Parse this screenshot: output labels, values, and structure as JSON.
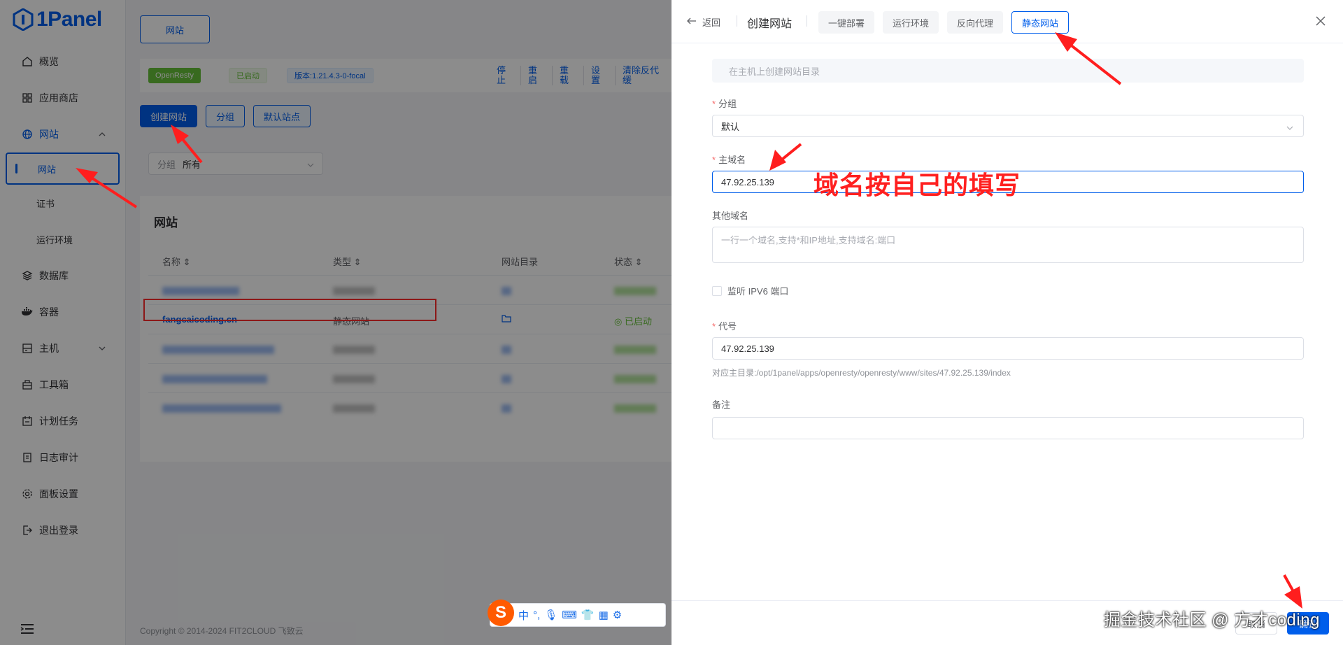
{
  "app": {
    "name": "1Panel"
  },
  "sidebar": {
    "items": [
      {
        "label": "概览",
        "icon": "home-icon"
      },
      {
        "label": "应用商店",
        "icon": "grid-icon"
      },
      {
        "label": "网站",
        "icon": "globe-icon"
      },
      {
        "label": "数据库",
        "icon": "layers-icon"
      },
      {
        "label": "容器",
        "icon": "docker-icon"
      },
      {
        "label": "主机",
        "icon": "server-icon"
      },
      {
        "label": "工具箱",
        "icon": "toolbox-icon"
      },
      {
        "label": "计划任务",
        "icon": "calendar-icon"
      },
      {
        "label": "日志审计",
        "icon": "document-icon"
      },
      {
        "label": "面板设置",
        "icon": "gear-icon"
      },
      {
        "label": "退出登录",
        "icon": "logout-icon"
      }
    ],
    "website_sub": [
      "网站",
      "证书",
      "运行环境"
    ]
  },
  "main": {
    "top_tab": "网站",
    "status": {
      "app": "OpenResty",
      "state": "已启动",
      "version": "版本:1.21.4.3-0-focal",
      "actions": [
        "停止",
        "重启",
        "重载",
        "设置",
        "清除反代缓"
      ]
    },
    "buttons": {
      "create": "创建网站",
      "group": "分组",
      "default_site": "默认站点"
    },
    "filter": {
      "label": "分组",
      "value": "所有"
    },
    "table": {
      "title": "网站",
      "headers": [
        "名称",
        "类型",
        "网站目录",
        "状态"
      ],
      "highlight_row": {
        "name": "fangcaicoding.cn",
        "type": "静态网站",
        "status": "已启动"
      }
    },
    "footer": "Copyright © 2014-2024 FIT2CLOUD 飞致云"
  },
  "ime": {
    "mode": "中"
  },
  "drawer": {
    "back": "返回",
    "title": "创建网站",
    "tabs": [
      "一键部署",
      "运行环境",
      "反向代理",
      "静态网站"
    ],
    "active_tab": "静态网站",
    "form": {
      "dir_placeholder": "在主机上创建网站目录",
      "group_label": "分组",
      "group_value": "默认",
      "domain_label": "主域名",
      "domain_value": "47.92.25.139",
      "other_label": "其他域名",
      "other_placeholder": "一行一个域名,支持*和IP地址,支持域名:端口",
      "ipv6_label": "监听 IPV6 端口",
      "code_label": "代号",
      "code_value": "47.92.25.139",
      "code_hint": "对应主目录:/opt/1panel/apps/openresty/openresty/www/sites/47.92.25.139/index",
      "remark_label": "备注"
    },
    "footer": {
      "cancel": "取消",
      "confirm": "确认"
    }
  },
  "annotation": {
    "text": "域名按自己的填写"
  },
  "watermark": "掘金技术社区 @ 方才coding",
  "colors": {
    "accent": "#005eeb",
    "annotation": "#ff2020",
    "success": "#67c23a"
  }
}
